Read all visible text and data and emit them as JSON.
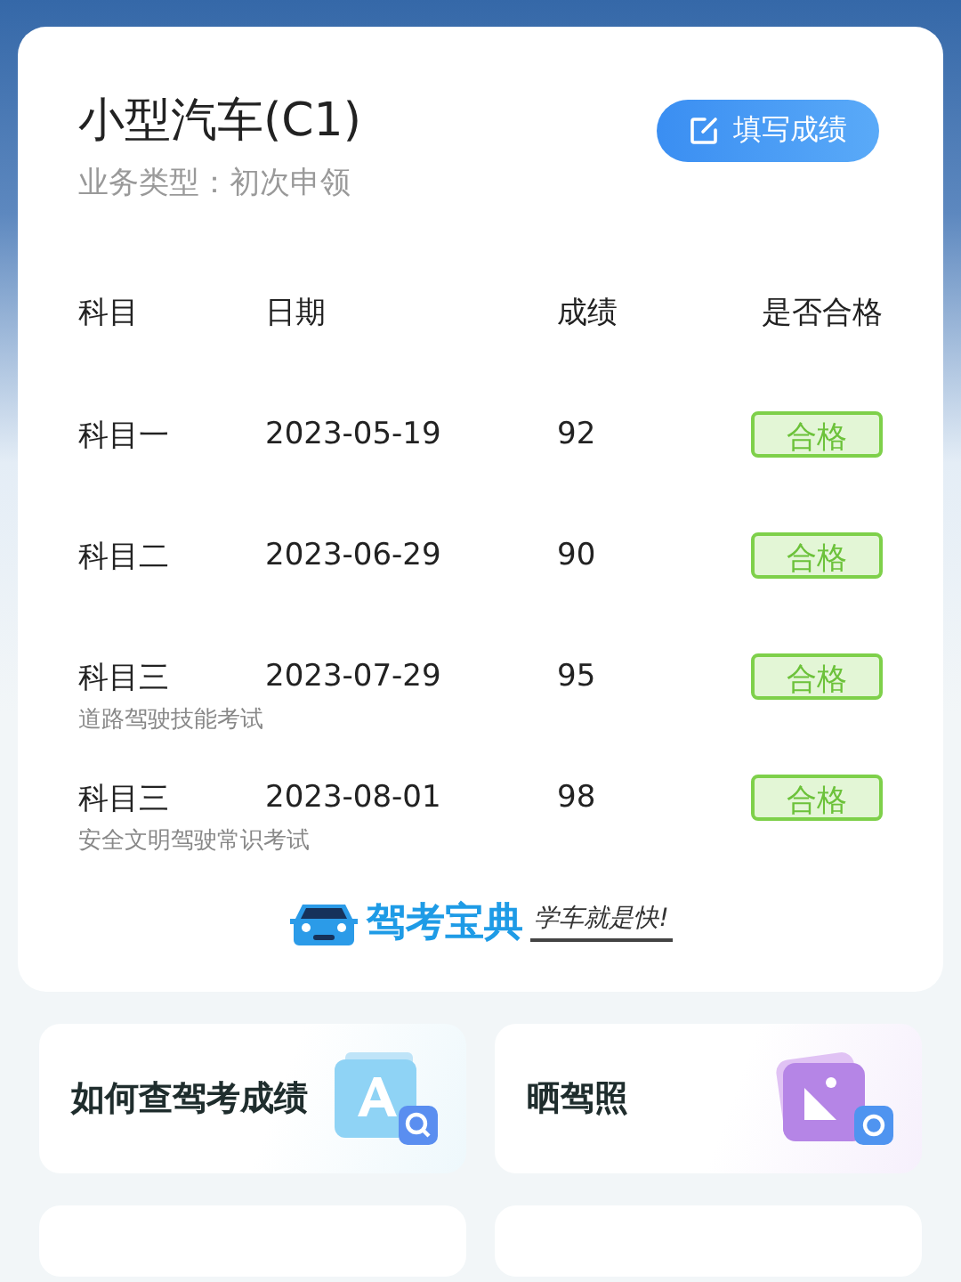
{
  "license": {
    "title": "小型汽车(C1)",
    "subtitle": "业务类型：初次申领",
    "button": "填写成绩"
  },
  "table": {
    "columns": [
      "科目",
      "日期",
      "成绩",
      "是否合格"
    ],
    "rows": [
      {
        "subject": "科目一",
        "date": "2023-05-19",
        "score": "92",
        "result": "合格",
        "passed": true
      },
      {
        "subject": "科目二",
        "date": "2023-06-29",
        "score": "90",
        "result": "合格",
        "passed": true
      },
      {
        "subject": "科目三",
        "note": "道路驾驶技能考试",
        "date": "2023-07-29",
        "score": "95",
        "result": "合格",
        "passed": true
      },
      {
        "subject": "科目三",
        "note": "安全文明驾驶常识考试",
        "date": "2023-08-01",
        "score": "98",
        "result": "合格",
        "passed": true
      }
    ]
  },
  "brand": {
    "name": "驾考宝典",
    "slogan": "学车就是快!"
  },
  "shortcuts": [
    {
      "label": "如何查驾考成绩",
      "kind": "search"
    },
    {
      "label": "晒驾照",
      "kind": "photo"
    }
  ]
}
